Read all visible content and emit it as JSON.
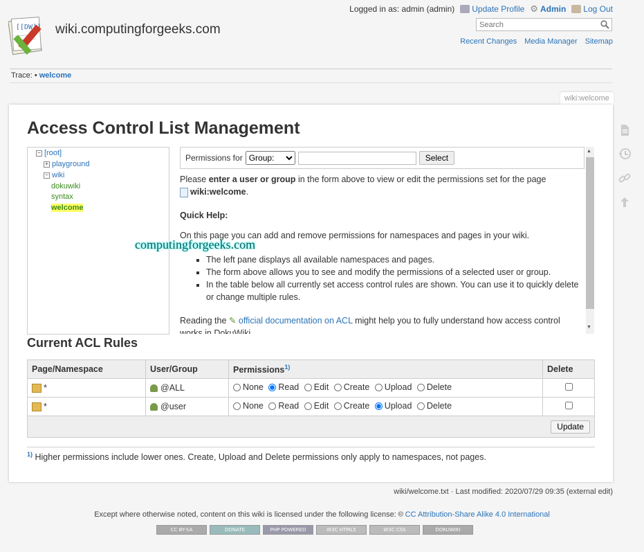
{
  "header": {
    "site_title": "wiki.computingforgeeks.com",
    "logged_in": "Logged in as: admin (admin)",
    "update_profile": "Update Profile",
    "admin": "Admin",
    "logout": "Log Out",
    "search_placeholder": "Search",
    "tools": [
      "Recent Changes",
      "Media Manager",
      "Sitemap"
    ]
  },
  "trace": {
    "label": "Trace:",
    "bullet": "•",
    "current": "welcome"
  },
  "page_id": "wiki:welcome",
  "title": "Access Control List Management",
  "tree": {
    "root": "[root]",
    "playground": "playground",
    "wiki": "wiki",
    "pages": [
      "dokuwiki",
      "syntax"
    ],
    "current": "welcome"
  },
  "form": {
    "permissions_for": "Permissions for",
    "select_value": "Group:",
    "select_button": "Select"
  },
  "help": {
    "intro_pre": "Please",
    "intro_bold": "enter a user or group",
    "intro_post": "in the form above to view or edit the permissions set for the page",
    "page": "wiki:welcome",
    "page_end": ".",
    "quick_help": "Quick Help:",
    "p1": "On this page you can add and remove permissions for namespaces and pages in your wiki.",
    "bullets": [
      "The left pane displays all available namespaces and pages.",
      "The form above allows you to see and modify the permissions of a selected user or group.",
      "In the table below all currently set access control rules are shown. You can use it to quickly delete or change multiple rules."
    ],
    "reading_pre": "Reading the",
    "reading_link": "official documentation on ACL",
    "reading_post": "might help you to fully understand how access control works in DokuWiki."
  },
  "watermark": "computingforgeeks.com",
  "acl": {
    "heading": "Current ACL Rules",
    "headers": {
      "page": "Page/Namespace",
      "user": "User/Group",
      "perms": "Permissions",
      "perms_sup": "1)",
      "delete": "Delete"
    },
    "perm_labels": [
      "None",
      "Read",
      "Edit",
      "Create",
      "Upload",
      "Delete"
    ],
    "rows": [
      {
        "page": "*",
        "user": "@ALL",
        "selected": "Read"
      },
      {
        "page": "*",
        "user": "@user",
        "selected": "Upload"
      }
    ],
    "update": "Update"
  },
  "footnote": {
    "mark": "1)",
    "text": "Higher permissions include lower ones. Create, Upload and Delete permissions only apply to namespaces, not pages."
  },
  "footer": {
    "docinfo": "wiki/welcome.txt · Last modified: 2020/07/29 09:35 (external edit)",
    "license_pre": "Except where otherwise noted, content on this wiki is licensed under the following license:",
    "license_link": "CC Attribution-Share Alike 4.0 International",
    "badges": [
      "CC BY-SA",
      "DONATE",
      "PHP POWERED",
      "W3C HTML5",
      "W3C CSS",
      "DOKUWIKI"
    ]
  },
  "colors": {
    "link": "#2b73b7",
    "current_highlight": "#ffff66",
    "page_link": "#3a8a1a"
  }
}
